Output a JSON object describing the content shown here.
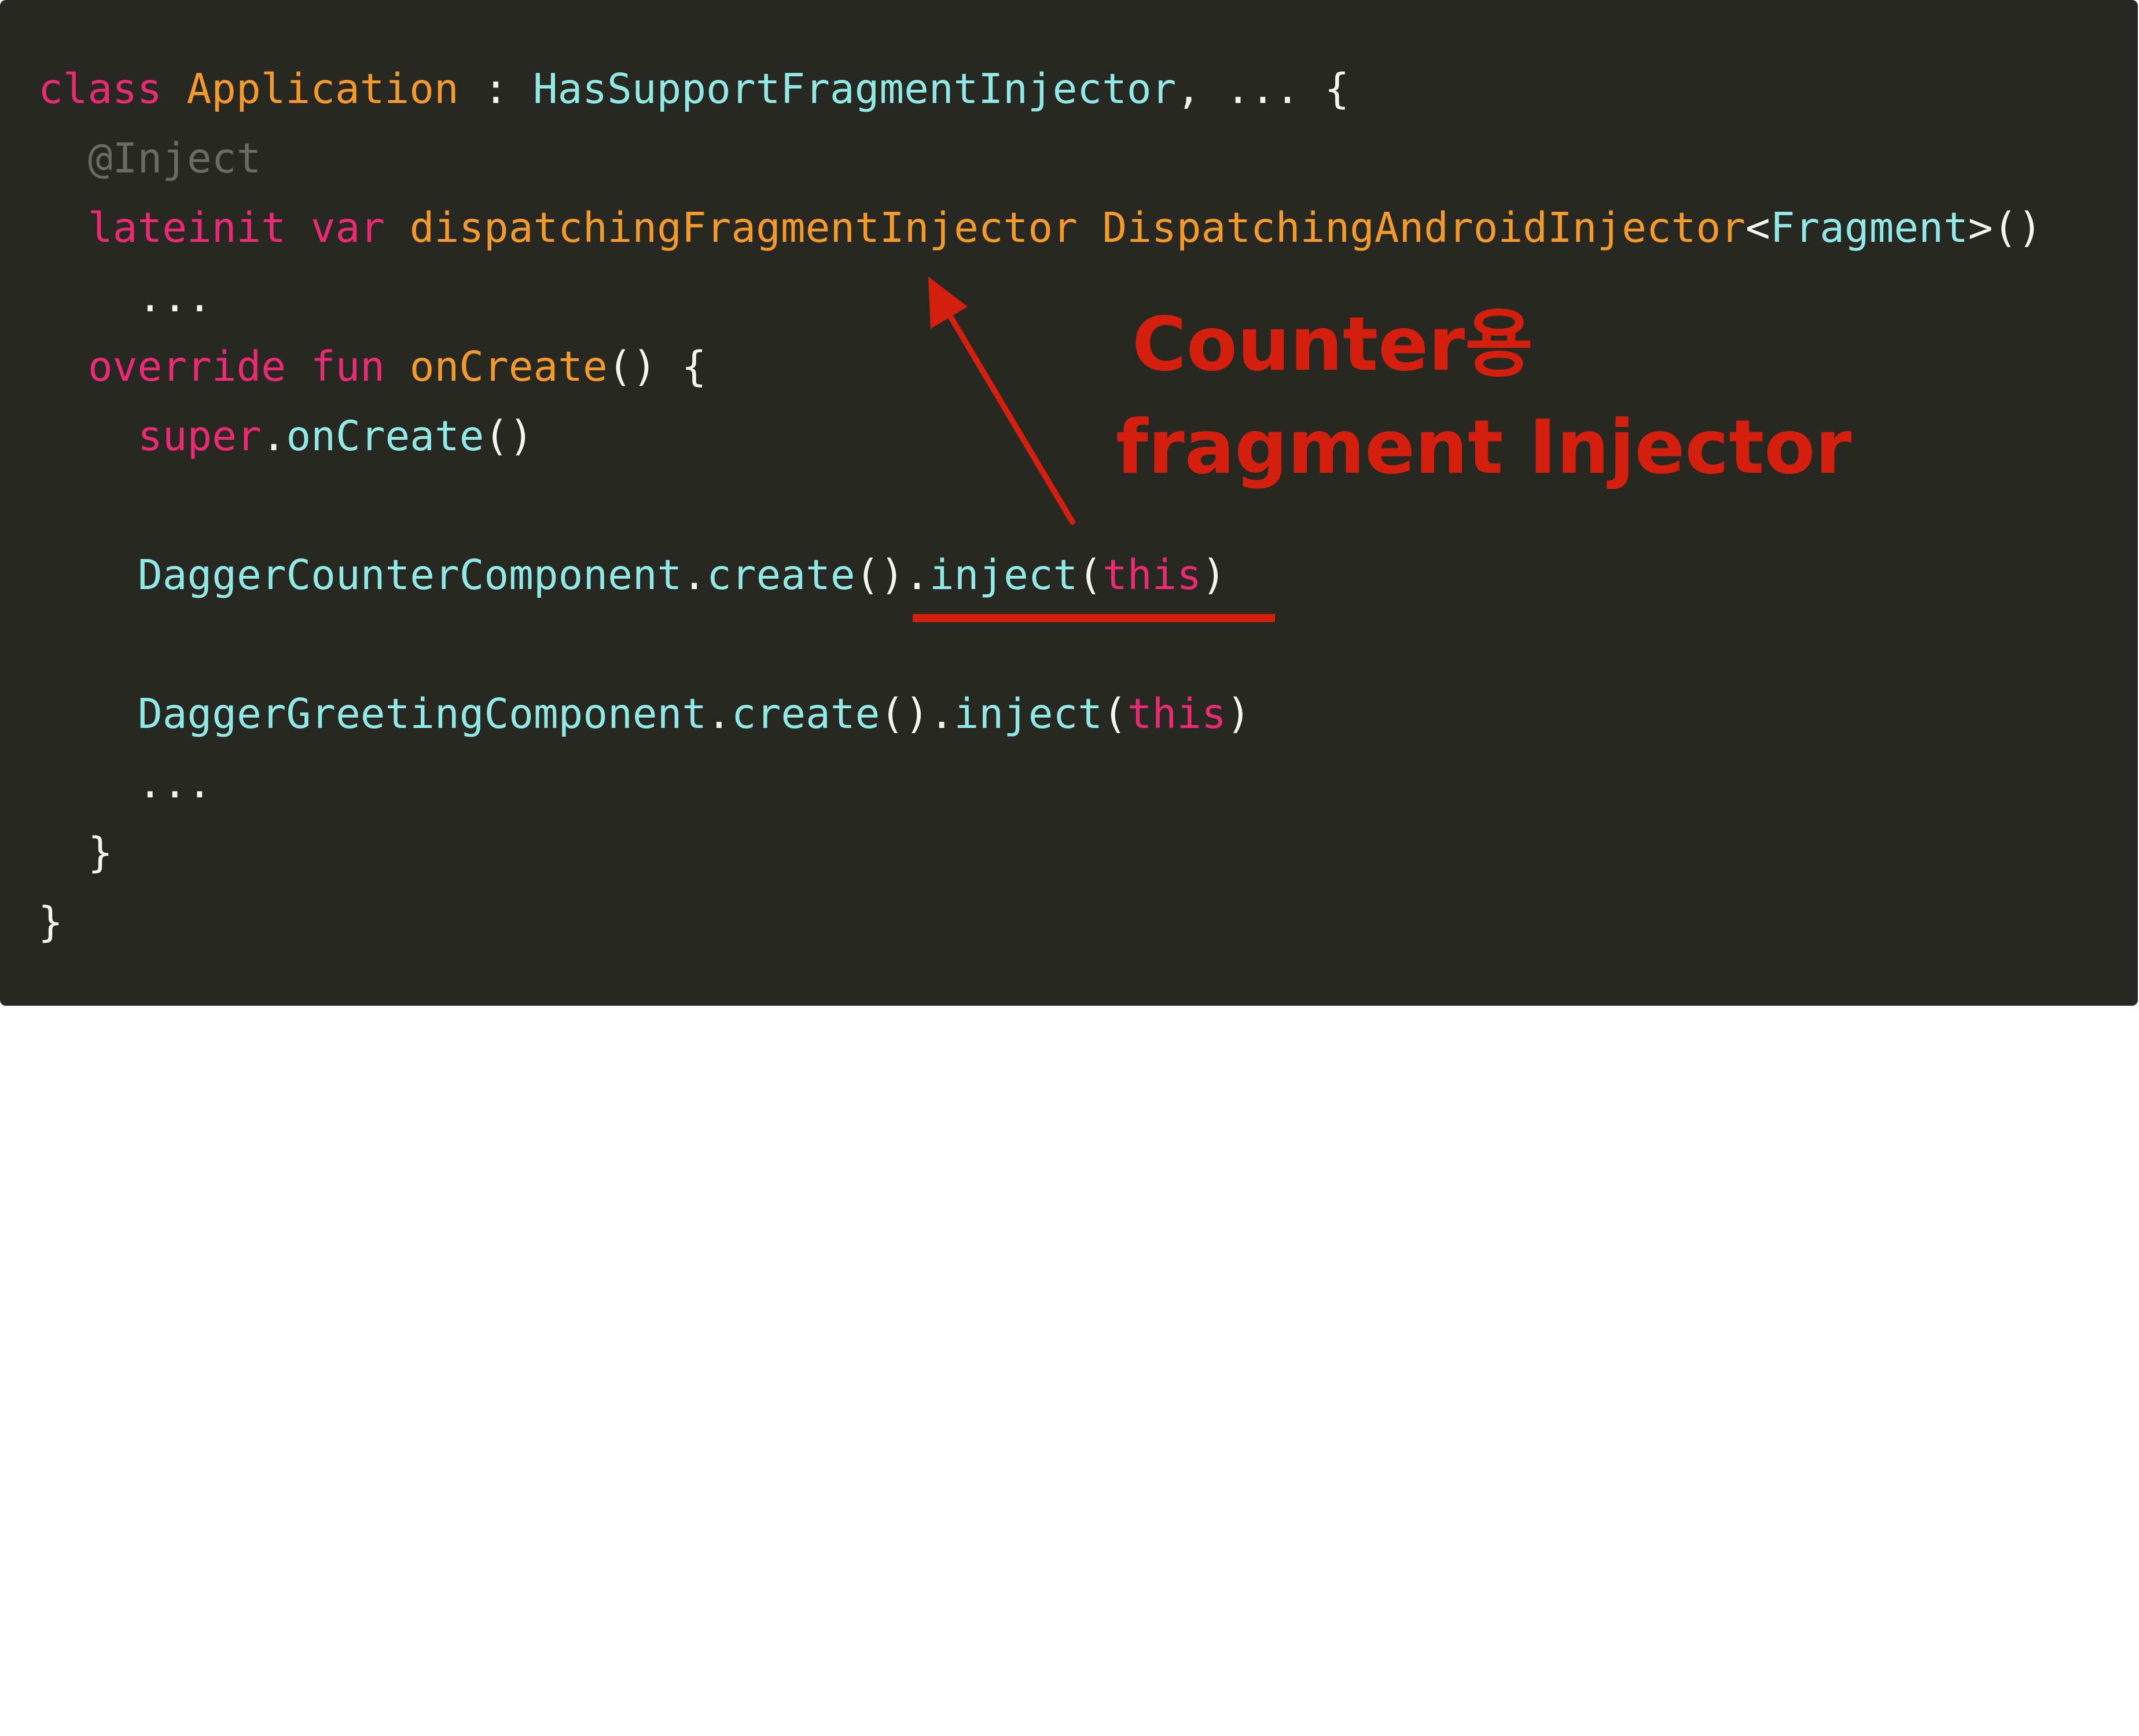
{
  "code": {
    "line1": {
      "kw_class": "class",
      "class_name": "Application",
      "colon": " : ",
      "interface": "HasSupportFragmentInjector",
      "rest": ", ... {"
    },
    "line2": {
      "annotation": "@Inject"
    },
    "line3": {
      "kw_lateinit": "lateinit",
      "kw_var": "var",
      "field_name": "dispatchingFragmentInjector",
      "field_type": "DispatchingAndroidInjector",
      "lt": "<",
      "generic": "Fragment",
      "gt_call": ">()"
    },
    "line4": {
      "ellipsis": "..."
    },
    "line5": {
      "kw_override": "override",
      "kw_fun": "fun",
      "method": "onCreate",
      "rest": "() {"
    },
    "line6": {
      "kw_super": "super",
      "dot": ".",
      "call": "onCreate",
      "parens": "()"
    },
    "line7": {
      "component": "DaggerCounterComponent",
      "dot1": ".",
      "create": "create",
      "parens1": "()",
      "dot2": ".",
      "inject": "inject",
      "open": "(",
      "kw_this": "this",
      "close": ")"
    },
    "line8": {
      "component": "DaggerGreetingComponent",
      "dot1": ".",
      "create": "create",
      "parens1": "()",
      "dot2": ".",
      "inject": "inject",
      "open": "(",
      "kw_this": "this",
      "close": ")"
    },
    "line9": {
      "ellipsis": "..."
    },
    "line10": {
      "brace": "}"
    },
    "line11": {
      "brace": "}"
    }
  },
  "annotation": {
    "line1": "Counter용",
    "line2": "fragment Injector"
  },
  "colors": {
    "background": "#282823",
    "keyword": "#ea2b74",
    "type_name": "#f39a29",
    "type_ref": "#91e9e6",
    "plain": "#f5f5f0",
    "comment": "#6b6b62",
    "highlight": "#d41f0e"
  }
}
